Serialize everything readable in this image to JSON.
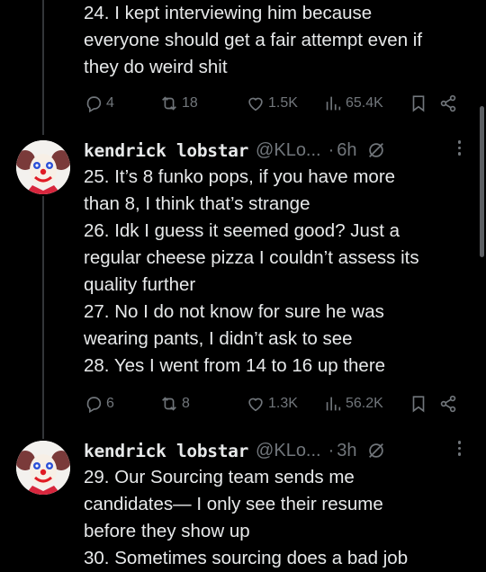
{
  "post_top": {
    "lines": [
      "24. I kept interviewing him because",
      "everyone should get a fair attempt even if",
      "they do weird shit"
    ],
    "actions": {
      "replies": "4",
      "reposts": "18",
      "likes": "1.5K",
      "views": "65.4K"
    }
  },
  "post_middle": {
    "author": {
      "name": "kendrick lobstar",
      "handle": "@KLo...",
      "separator": "·",
      "time": "6h"
    },
    "lines": [
      "25. It’s 8 funko pops, if you have more",
      "than 8, I think that’s strange",
      "26. Idk I guess it seemed good? Just a",
      "regular cheese pizza I couldn’t assess its",
      "quality further",
      "27. No I do not know for sure he was",
      "wearing pants, I didn’t ask to see",
      "28. Yes I went from 14 to 16 up there"
    ],
    "actions": {
      "replies": "6",
      "reposts": "8",
      "likes": "1.3K",
      "views": "56.2K"
    }
  },
  "post_bottom": {
    "author": {
      "name": "kendrick lobstar",
      "handle": "@KLo...",
      "separator": "·",
      "time": "3h"
    },
    "lines": [
      "29. Our Sourcing team sends me",
      "candidates— I only see their resume",
      "before they show up",
      "30. Sometimes sourcing does a bad job"
    ]
  },
  "icons": {
    "reply": "reply-icon",
    "repost": "repost-icon",
    "like": "heart-icon",
    "views": "views-icon",
    "bookmark": "bookmark-icon",
    "share": "share-icon",
    "grok": "grok-icon",
    "more": "more-icon"
  },
  "colors": {
    "background": "#000000",
    "text": "#e7e9ea",
    "muted": "#71767b",
    "thread_line": "#333639"
  }
}
